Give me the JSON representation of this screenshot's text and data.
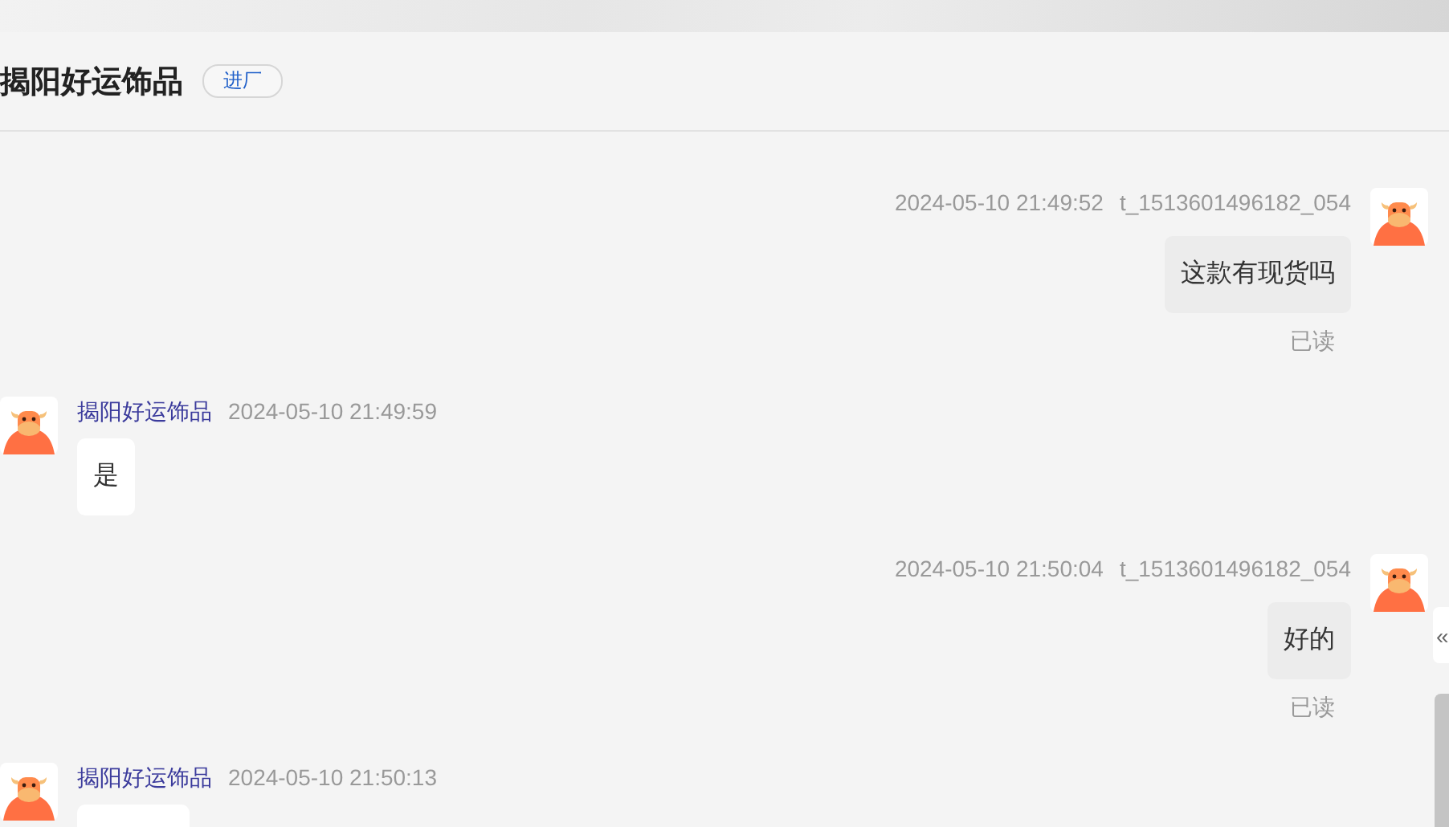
{
  "header": {
    "title": "揭阳好运饰品",
    "badge": "进厂"
  },
  "messages": [
    {
      "kind": "sent",
      "time": "2024-05-10 21:49:52",
      "sender": "t_1513601496182_054",
      "text": "这款有现货吗",
      "receipt": "已读"
    },
    {
      "kind": "received",
      "sender": "揭阳好运饰品",
      "time": "2024-05-10 21:49:59",
      "text": "是"
    },
    {
      "kind": "sent",
      "time": "2024-05-10 21:50:04",
      "sender": "t_1513601496182_054",
      "text": "好的",
      "receipt": "已读"
    },
    {
      "kind": "received",
      "sender": "揭阳好运饰品",
      "time": "2024-05-10 21:50:13"
    }
  ],
  "side_tab": {
    "glyph": "«"
  }
}
